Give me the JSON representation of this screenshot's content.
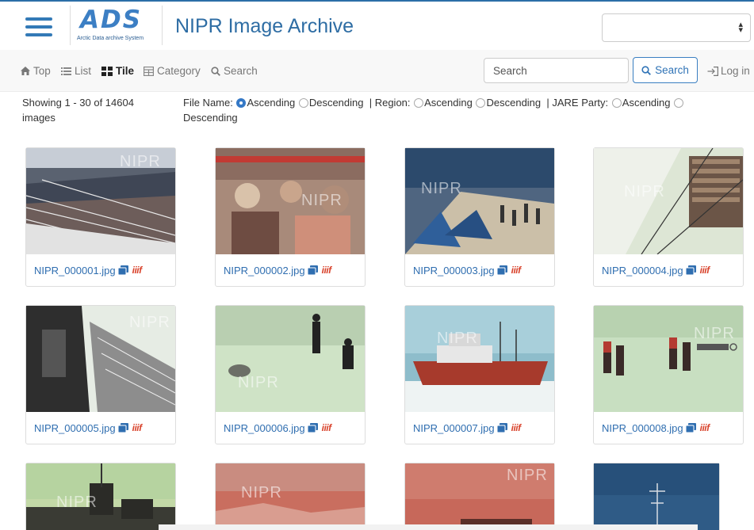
{
  "header": {
    "logo_text": "ADS",
    "logo_subtitle": "Arctic Data archive System",
    "title": "NIPR Image Archive",
    "language_select_value": ""
  },
  "nav": {
    "items": [
      {
        "label": "Top",
        "icon": "home-icon"
      },
      {
        "label": "List",
        "icon": "list-icon"
      },
      {
        "label": "Tile",
        "icon": "tile-icon",
        "active": true
      },
      {
        "label": "Category",
        "icon": "category-icon"
      },
      {
        "label": "Search",
        "icon": "search-icon"
      }
    ],
    "search_placeholder": "Search",
    "search_button": "Search",
    "login": "Log in"
  },
  "results": {
    "showing": "Showing 1 - 30 of 14604 images"
  },
  "sort": {
    "file_name_label": "File Name:",
    "region_label": "| Region:",
    "jare_label": "| JARE Party:",
    "ascending": "Ascending",
    "descending": "Descending",
    "selected": "file_name_ascending"
  },
  "images": [
    {
      "file": "NIPR_000001.jpg",
      "watermark": "NIPR"
    },
    {
      "file": "NIPR_000002.jpg",
      "watermark": "NIPR"
    },
    {
      "file": "NIPR_000003.jpg",
      "watermark": "NIPR"
    },
    {
      "file": "NIPR_000004.jpg",
      "watermark": "NIPR"
    },
    {
      "file": "NIPR_000005.jpg",
      "watermark": "NIPR"
    },
    {
      "file": "NIPR_000006.jpg",
      "watermark": "NIPR"
    },
    {
      "file": "NIPR_000007.jpg",
      "watermark": "NIPR"
    },
    {
      "file": "NIPR_000008.jpg",
      "watermark": "NIPR"
    },
    {
      "file": "",
      "watermark": "NIPR"
    },
    {
      "file": "",
      "watermark": "NIPR"
    },
    {
      "file": "",
      "watermark": "NIPR"
    },
    {
      "file": "",
      "watermark": ""
    }
  ],
  "iiif_label": "iiif",
  "colors": {
    "brand_blue": "#2e6da4",
    "link_blue": "#2f6eb0",
    "iiif_red": "#d9452e"
  }
}
